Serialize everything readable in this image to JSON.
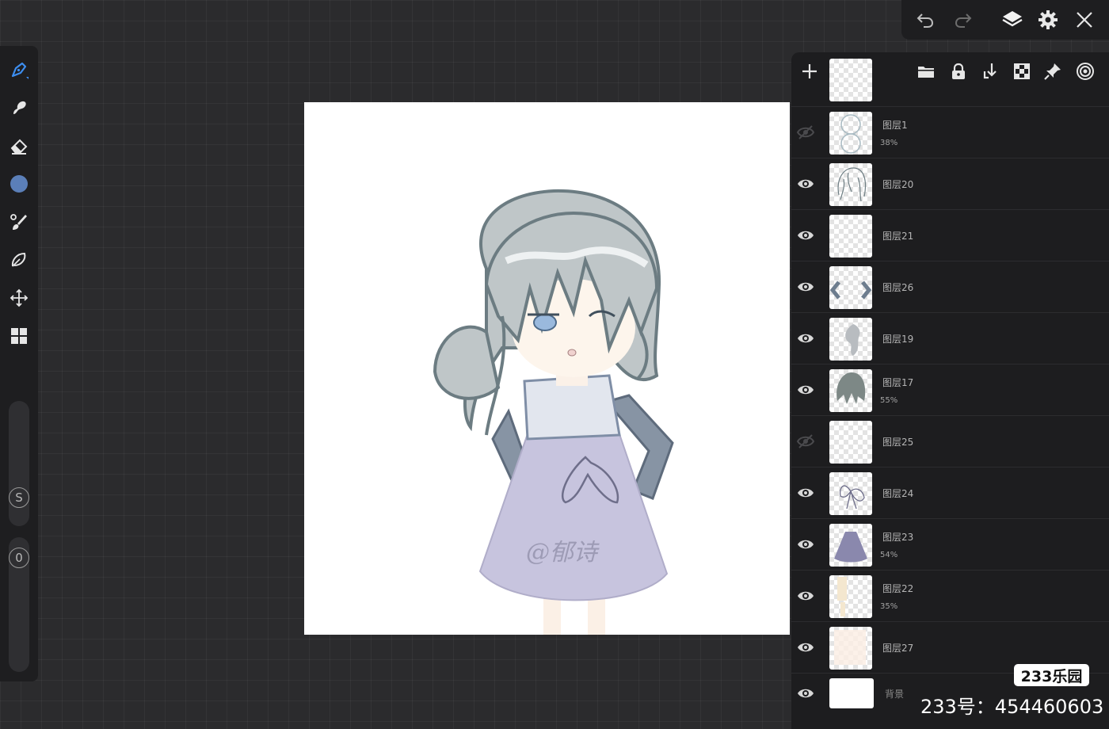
{
  "toolbar": {
    "tools": [
      "brush-tool",
      "smudge-tool",
      "eraser-tool",
      "color-picker",
      "stabilizer-tool",
      "lasso-tool",
      "transform-tool",
      "gallery-tool"
    ],
    "active_color": "#5b7fb8",
    "size_label": "S",
    "opacity_label": "0"
  },
  "topbar": {
    "icons": [
      "undo-icon",
      "redo-icon",
      "layers-icon",
      "settings-icon",
      "close-icon"
    ]
  },
  "layers_panel": {
    "header_icons": [
      "add-layer-icon",
      "folder-icon",
      "lock-icon",
      "merge-down-icon",
      "alpha-lock-icon",
      "pin-icon",
      "target-icon"
    ],
    "layers": [
      {
        "name": "图层1",
        "opacity": "38%",
        "visible": false
      },
      {
        "name": "图层20",
        "opacity": "",
        "visible": true
      },
      {
        "name": "图层21",
        "opacity": "",
        "visible": true
      },
      {
        "name": "图层26",
        "opacity": "",
        "visible": true
      },
      {
        "name": "图层19",
        "opacity": "",
        "visible": true
      },
      {
        "name": "图层17",
        "opacity": "55%",
        "visible": true
      },
      {
        "name": "图层25",
        "opacity": "",
        "visible": false
      },
      {
        "name": "图层24",
        "opacity": "",
        "visible": true
      },
      {
        "name": "图层23",
        "opacity": "54%",
        "visible": true
      },
      {
        "name": "图层22",
        "opacity": "35%",
        "visible": true
      },
      {
        "name": "图层27",
        "opacity": "",
        "visible": true
      },
      {
        "name": "背景",
        "opacity": "",
        "visible": true
      }
    ]
  },
  "canvas": {
    "signature": "@郁诗"
  },
  "watermark": {
    "brand": "233乐园",
    "id": "233号：454460603"
  }
}
